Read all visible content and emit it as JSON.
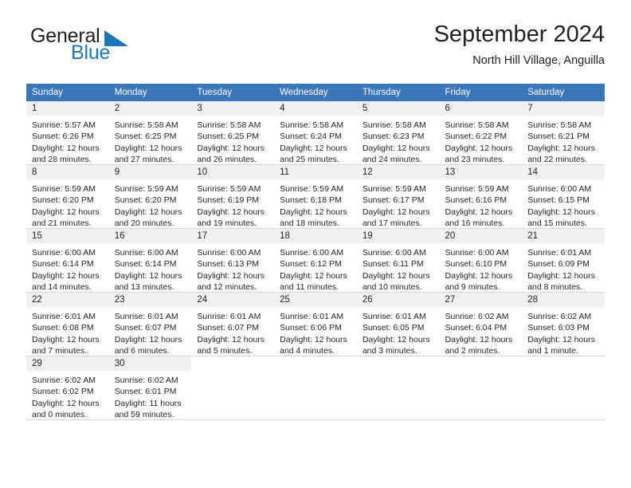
{
  "logo": {
    "word1": "General",
    "word2": "Blue",
    "triangle_color": "#1b75bb"
  },
  "header": {
    "title": "September 2024",
    "location": "North Hill Village, Anguilla"
  },
  "theme": {
    "header_blue": "#3b77b8",
    "daynum_gray": "#f1f1f1",
    "row_divider": "#d9d9d9",
    "text": "#231f20"
  },
  "weekdays": [
    "Sunday",
    "Monday",
    "Tuesday",
    "Wednesday",
    "Thursday",
    "Friday",
    "Saturday"
  ],
  "weeks": [
    [
      {
        "day": "1",
        "sunrise": "Sunrise: 5:57 AM",
        "sunset": "Sunset: 6:26 PM",
        "daylight": "Daylight: 12 hours and 28 minutes."
      },
      {
        "day": "2",
        "sunrise": "Sunrise: 5:58 AM",
        "sunset": "Sunset: 6:25 PM",
        "daylight": "Daylight: 12 hours and 27 minutes."
      },
      {
        "day": "3",
        "sunrise": "Sunrise: 5:58 AM",
        "sunset": "Sunset: 6:25 PM",
        "daylight": "Daylight: 12 hours and 26 minutes."
      },
      {
        "day": "4",
        "sunrise": "Sunrise: 5:58 AM",
        "sunset": "Sunset: 6:24 PM",
        "daylight": "Daylight: 12 hours and 25 minutes."
      },
      {
        "day": "5",
        "sunrise": "Sunrise: 5:58 AM",
        "sunset": "Sunset: 6:23 PM",
        "daylight": "Daylight: 12 hours and 24 minutes."
      },
      {
        "day": "6",
        "sunrise": "Sunrise: 5:58 AM",
        "sunset": "Sunset: 6:22 PM",
        "daylight": "Daylight: 12 hours and 23 minutes."
      },
      {
        "day": "7",
        "sunrise": "Sunrise: 5:58 AM",
        "sunset": "Sunset: 6:21 PM",
        "daylight": "Daylight: 12 hours and 22 minutes."
      }
    ],
    [
      {
        "day": "8",
        "sunrise": "Sunrise: 5:59 AM",
        "sunset": "Sunset: 6:20 PM",
        "daylight": "Daylight: 12 hours and 21 minutes."
      },
      {
        "day": "9",
        "sunrise": "Sunrise: 5:59 AM",
        "sunset": "Sunset: 6:20 PM",
        "daylight": "Daylight: 12 hours and 20 minutes."
      },
      {
        "day": "10",
        "sunrise": "Sunrise: 5:59 AM",
        "sunset": "Sunset: 6:19 PM",
        "daylight": "Daylight: 12 hours and 19 minutes."
      },
      {
        "day": "11",
        "sunrise": "Sunrise: 5:59 AM",
        "sunset": "Sunset: 6:18 PM",
        "daylight": "Daylight: 12 hours and 18 minutes."
      },
      {
        "day": "12",
        "sunrise": "Sunrise: 5:59 AM",
        "sunset": "Sunset: 6:17 PM",
        "daylight": "Daylight: 12 hours and 17 minutes."
      },
      {
        "day": "13",
        "sunrise": "Sunrise: 5:59 AM",
        "sunset": "Sunset: 6:16 PM",
        "daylight": "Daylight: 12 hours and 16 minutes."
      },
      {
        "day": "14",
        "sunrise": "Sunrise: 6:00 AM",
        "sunset": "Sunset: 6:15 PM",
        "daylight": "Daylight: 12 hours and 15 minutes."
      }
    ],
    [
      {
        "day": "15",
        "sunrise": "Sunrise: 6:00 AM",
        "sunset": "Sunset: 6:14 PM",
        "daylight": "Daylight: 12 hours and 14 minutes."
      },
      {
        "day": "16",
        "sunrise": "Sunrise: 6:00 AM",
        "sunset": "Sunset: 6:14 PM",
        "daylight": "Daylight: 12 hours and 13 minutes."
      },
      {
        "day": "17",
        "sunrise": "Sunrise: 6:00 AM",
        "sunset": "Sunset: 6:13 PM",
        "daylight": "Daylight: 12 hours and 12 minutes."
      },
      {
        "day": "18",
        "sunrise": "Sunrise: 6:00 AM",
        "sunset": "Sunset: 6:12 PM",
        "daylight": "Daylight: 12 hours and 11 minutes."
      },
      {
        "day": "19",
        "sunrise": "Sunrise: 6:00 AM",
        "sunset": "Sunset: 6:11 PM",
        "daylight": "Daylight: 12 hours and 10 minutes."
      },
      {
        "day": "20",
        "sunrise": "Sunrise: 6:00 AM",
        "sunset": "Sunset: 6:10 PM",
        "daylight": "Daylight: 12 hours and 9 minutes."
      },
      {
        "day": "21",
        "sunrise": "Sunrise: 6:01 AM",
        "sunset": "Sunset: 6:09 PM",
        "daylight": "Daylight: 12 hours and 8 minutes."
      }
    ],
    [
      {
        "day": "22",
        "sunrise": "Sunrise: 6:01 AM",
        "sunset": "Sunset: 6:08 PM",
        "daylight": "Daylight: 12 hours and 7 minutes."
      },
      {
        "day": "23",
        "sunrise": "Sunrise: 6:01 AM",
        "sunset": "Sunset: 6:07 PM",
        "daylight": "Daylight: 12 hours and 6 minutes."
      },
      {
        "day": "24",
        "sunrise": "Sunrise: 6:01 AM",
        "sunset": "Sunset: 6:07 PM",
        "daylight": "Daylight: 12 hours and 5 minutes."
      },
      {
        "day": "25",
        "sunrise": "Sunrise: 6:01 AM",
        "sunset": "Sunset: 6:06 PM",
        "daylight": "Daylight: 12 hours and 4 minutes."
      },
      {
        "day": "26",
        "sunrise": "Sunrise: 6:01 AM",
        "sunset": "Sunset: 6:05 PM",
        "daylight": "Daylight: 12 hours and 3 minutes."
      },
      {
        "day": "27",
        "sunrise": "Sunrise: 6:02 AM",
        "sunset": "Sunset: 6:04 PM",
        "daylight": "Daylight: 12 hours and 2 minutes."
      },
      {
        "day": "28",
        "sunrise": "Sunrise: 6:02 AM",
        "sunset": "Sunset: 6:03 PM",
        "daylight": "Daylight: 12 hours and 1 minute."
      }
    ],
    [
      {
        "day": "29",
        "sunrise": "Sunrise: 6:02 AM",
        "sunset": "Sunset: 6:02 PM",
        "daylight": "Daylight: 12 hours and 0 minutes."
      },
      {
        "day": "30",
        "sunrise": "Sunrise: 6:02 AM",
        "sunset": "Sunset: 6:01 PM",
        "daylight": "Daylight: 11 hours and 59 minutes."
      },
      {
        "day": "",
        "sunrise": "",
        "sunset": "",
        "daylight": ""
      },
      {
        "day": "",
        "sunrise": "",
        "sunset": "",
        "daylight": ""
      },
      {
        "day": "",
        "sunrise": "",
        "sunset": "",
        "daylight": ""
      },
      {
        "day": "",
        "sunrise": "",
        "sunset": "",
        "daylight": ""
      },
      {
        "day": "",
        "sunrise": "",
        "sunset": "",
        "daylight": ""
      }
    ]
  ]
}
